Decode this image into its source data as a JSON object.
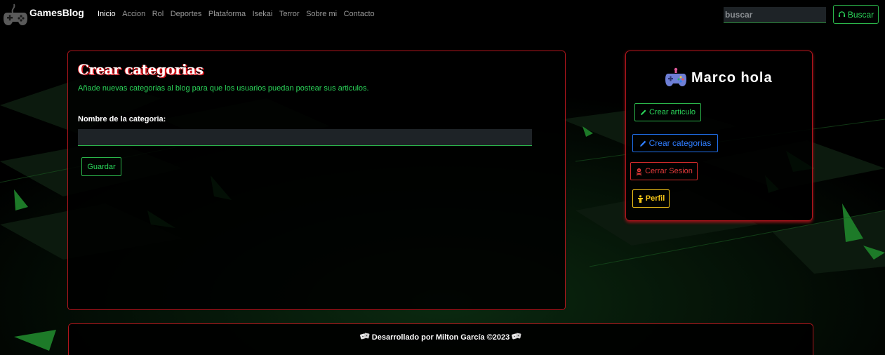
{
  "colors": {
    "accent_green": "#2bd65a",
    "accent_red": "#b0151c",
    "accent_blue": "#2f7dff",
    "accent_yellow": "#f5c518",
    "input_bg": "#1e2327"
  },
  "navbar": {
    "brand": "GamesBlog",
    "brand_icon": "gamepad-icon",
    "links": [
      {
        "label": "Inicio",
        "active": true
      },
      {
        "label": "Accion"
      },
      {
        "label": "Rol"
      },
      {
        "label": "Deportes"
      },
      {
        "label": "Plataforma"
      },
      {
        "label": "Isekai"
      },
      {
        "label": "Terror"
      },
      {
        "label": "Sobre mi"
      },
      {
        "label": "Contacto"
      }
    ],
    "search": {
      "placeholder": "buscar",
      "value": ""
    },
    "search_button": {
      "label": "Buscar",
      "icon": "headset-icon"
    }
  },
  "main": {
    "title": "Crear categorias",
    "subtitle": "Añade nuevas categorias al blog para que los usuarios puedan postear sus articulos.",
    "field_label": "Nombre de la categoria:",
    "field_value": "",
    "save_button": "Guardar"
  },
  "sidebar": {
    "user_name": "Marco hola",
    "user_icon": "game-controller-icon",
    "buttons": [
      {
        "label": "Crear articulo",
        "icon": "pencil-icon"
      },
      {
        "label": "Crear categorias",
        "icon": "pencil-icon"
      },
      {
        "label": "Cerrar Sesion",
        "icon": "skull-crossbones-icon"
      },
      {
        "label": "Perfil",
        "icon": "person-icon"
      }
    ]
  },
  "footer": {
    "text": "Desarrollado por Milton García ©2023",
    "icon": "dice-icon"
  }
}
